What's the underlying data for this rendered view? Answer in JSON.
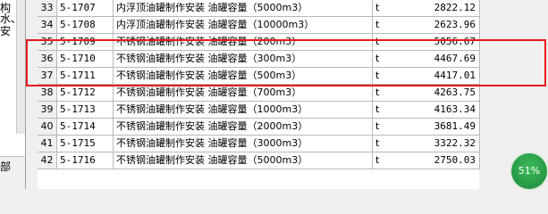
{
  "left_panel": {
    "fragments": [
      "构",
      "水、",
      "安"
    ],
    "bottom_fragment": "部"
  },
  "rows": [
    {
      "num": "33",
      "code": "5-1707",
      "name": "内浮顶油罐制作安装  油罐容量（5000m3）",
      "unit": "t",
      "price": "2822.12"
    },
    {
      "num": "34",
      "code": "5-1708",
      "name": "内浮顶油罐制作安装  油罐容量（10000m3）",
      "unit": "t",
      "price": "2623.96"
    },
    {
      "num": "35",
      "code": "5-1709",
      "name": "不锈钢油罐制作安装  油罐容量（200m3）",
      "unit": "t",
      "price": "5056.67"
    },
    {
      "num": "36",
      "code": "5-1710",
      "name": "不锈钢油罐制作安装  油罐容量（300m3）",
      "unit": "t",
      "price": "4467.69"
    },
    {
      "num": "37",
      "code": "5-1711",
      "name": "不锈钢油罐制作安装  油罐容量（500m3）",
      "unit": "t",
      "price": "4417.01"
    },
    {
      "num": "38",
      "code": "5-1712",
      "name": "不锈钢油罐制作安装  油罐容量（700m3）",
      "unit": "t",
      "price": "4263.75"
    },
    {
      "num": "39",
      "code": "5-1713",
      "name": "不锈钢油罐制作安装  油罐容量（1000m3）",
      "unit": "t",
      "price": "4163.34"
    },
    {
      "num": "40",
      "code": "5-1714",
      "name": "不锈钢油罐制作安装  油罐容量（2000m3）",
      "unit": "t",
      "price": "3681.49"
    },
    {
      "num": "41",
      "code": "5-1715",
      "name": "不锈钢油罐制作安装  油罐容量（3000m3）",
      "unit": "t",
      "price": "3322.32"
    },
    {
      "num": "42",
      "code": "5-1716",
      "name": "不锈钢油罐制作安装  油罐容量（5000m3）",
      "unit": "t",
      "price": "2750.03"
    }
  ],
  "badge": {
    "text": "51%",
    "color": "#2ea14a"
  },
  "highlight_color": "#e8191d"
}
